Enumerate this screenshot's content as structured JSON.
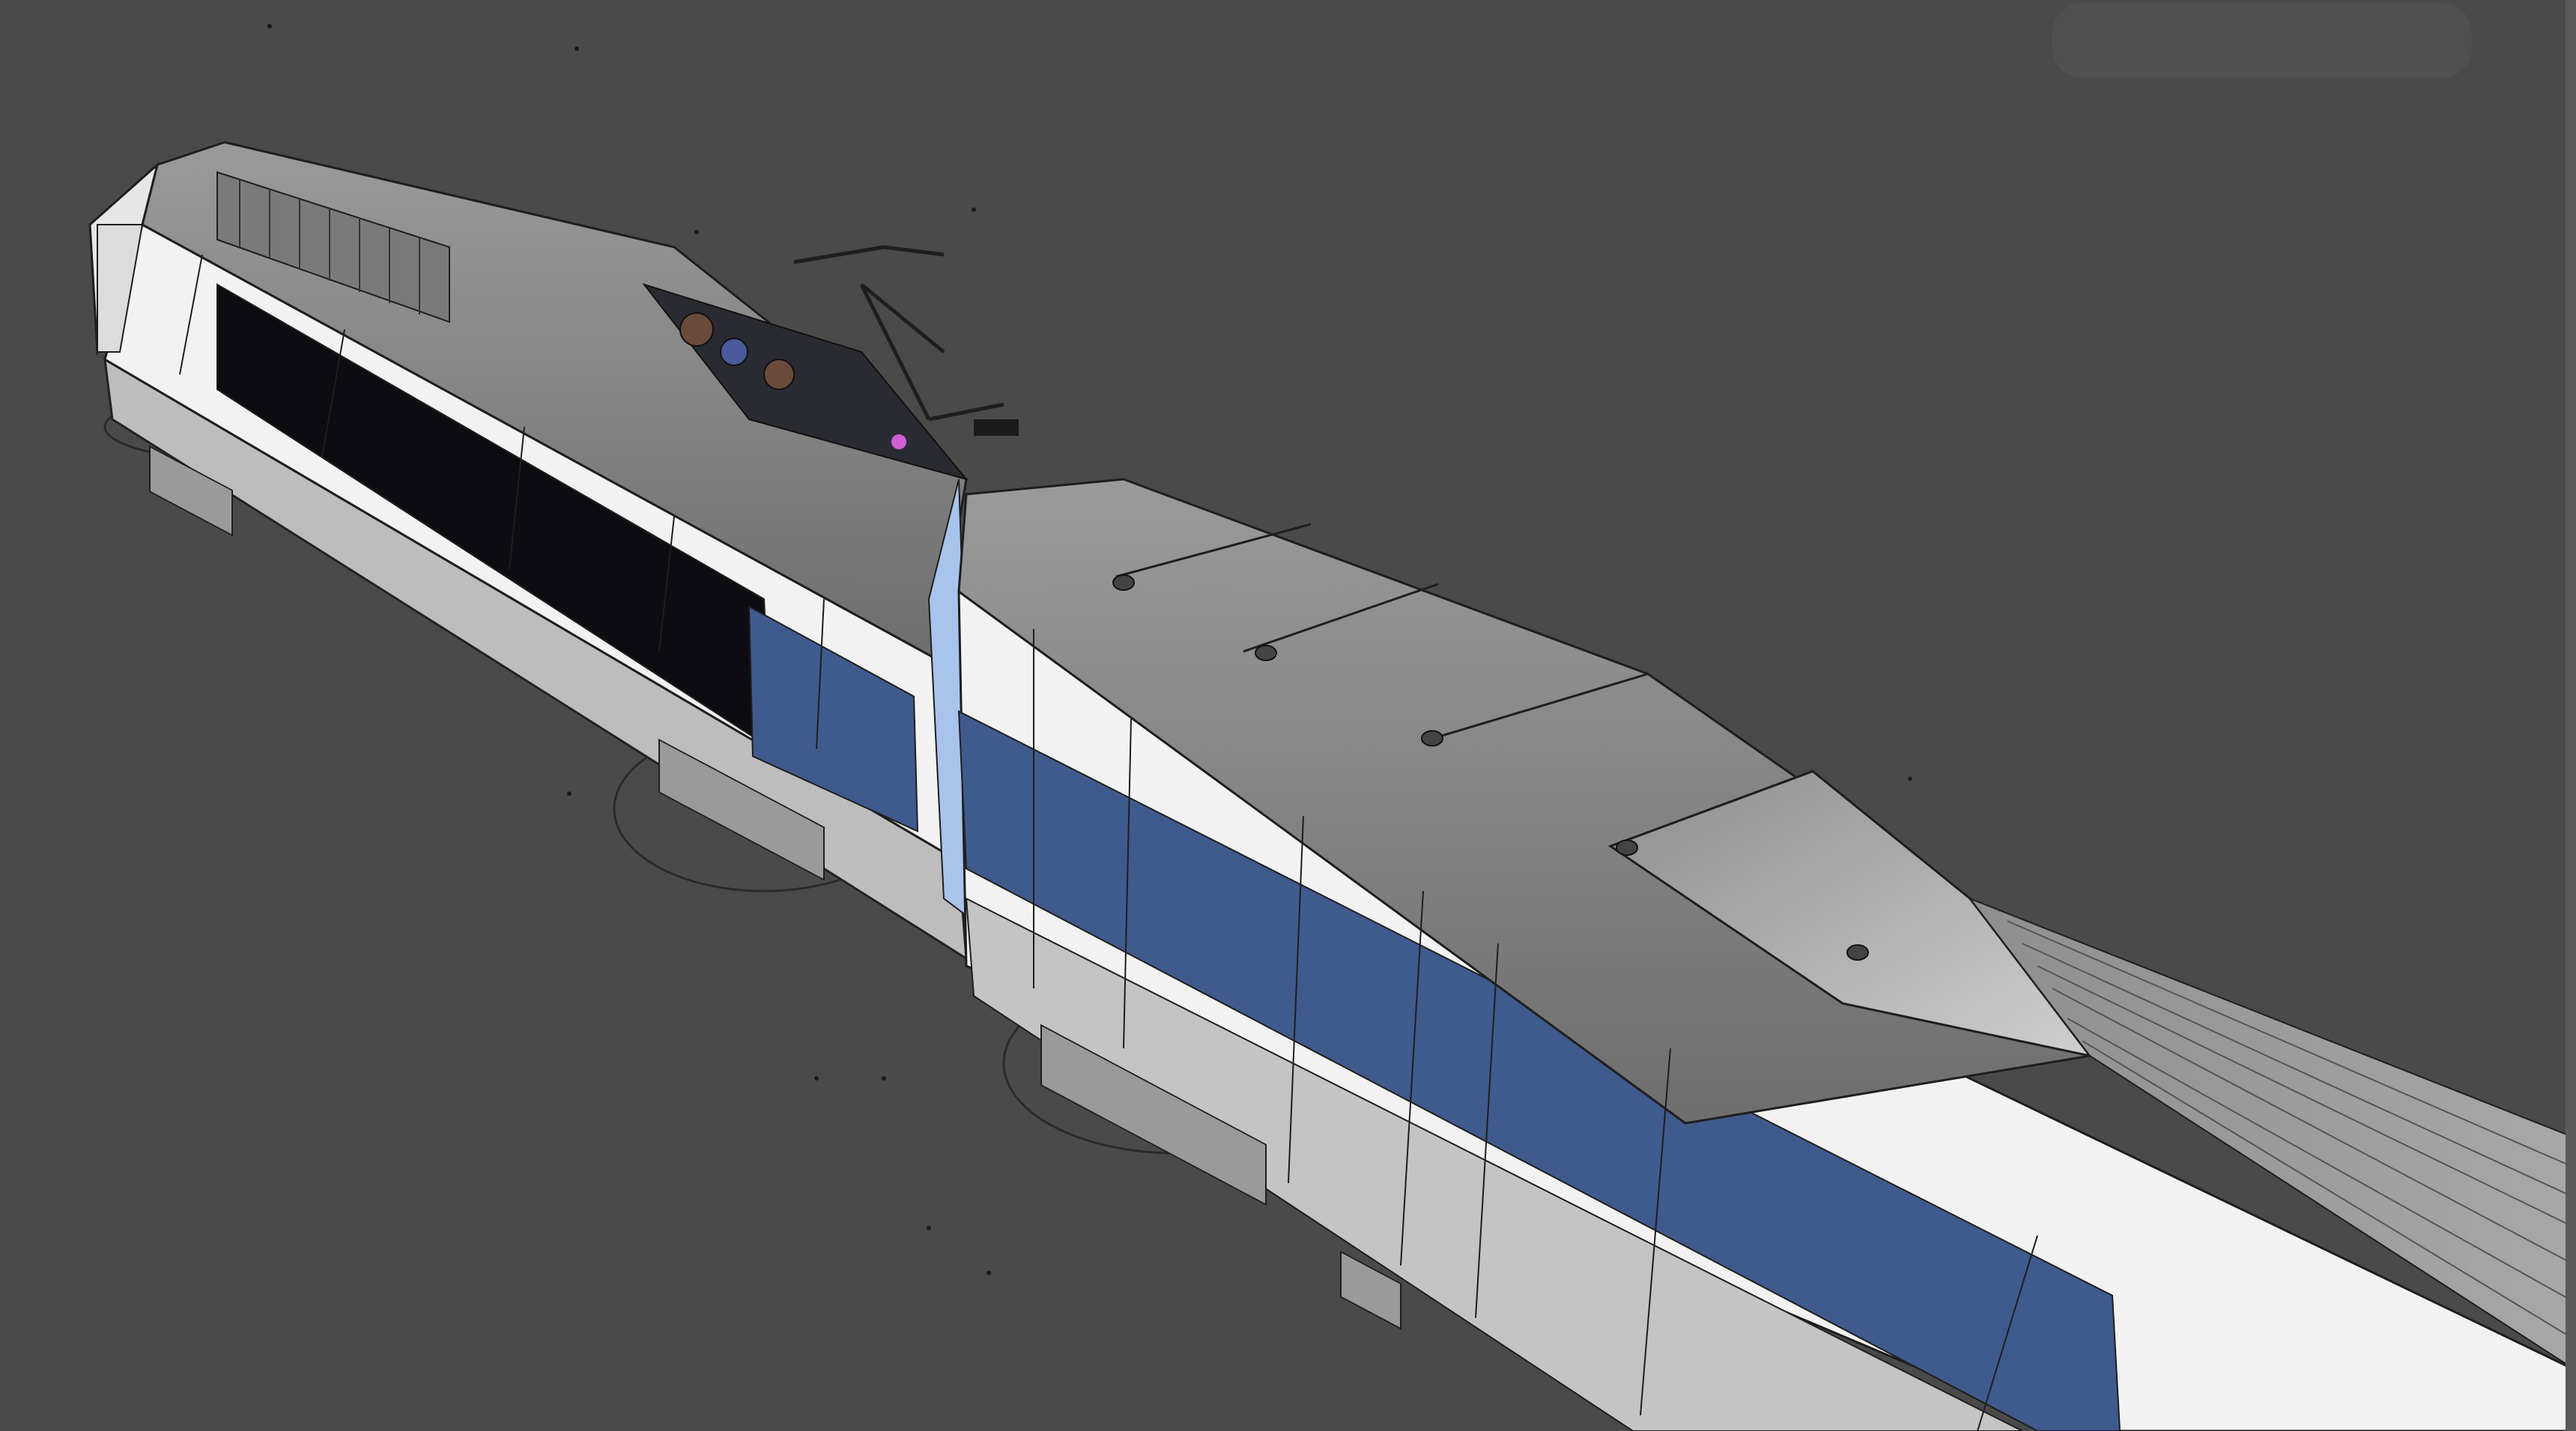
{
  "viewport": {
    "background": "#4a4a4a",
    "mode": "shaded-with-edges"
  },
  "model": {
    "subject": "high-speed-train",
    "colors": {
      "body_white": "#f2f2f2",
      "stripe_blue": "#3f5a8c",
      "window_band": "#0c0c12",
      "roof_grey": "#8a8a8a",
      "roof_dark": "#6f6f6f",
      "wire": "#1e1e1e",
      "highlight_pink": "#d060d0",
      "pale_blue": "#a8c4ec"
    }
  }
}
